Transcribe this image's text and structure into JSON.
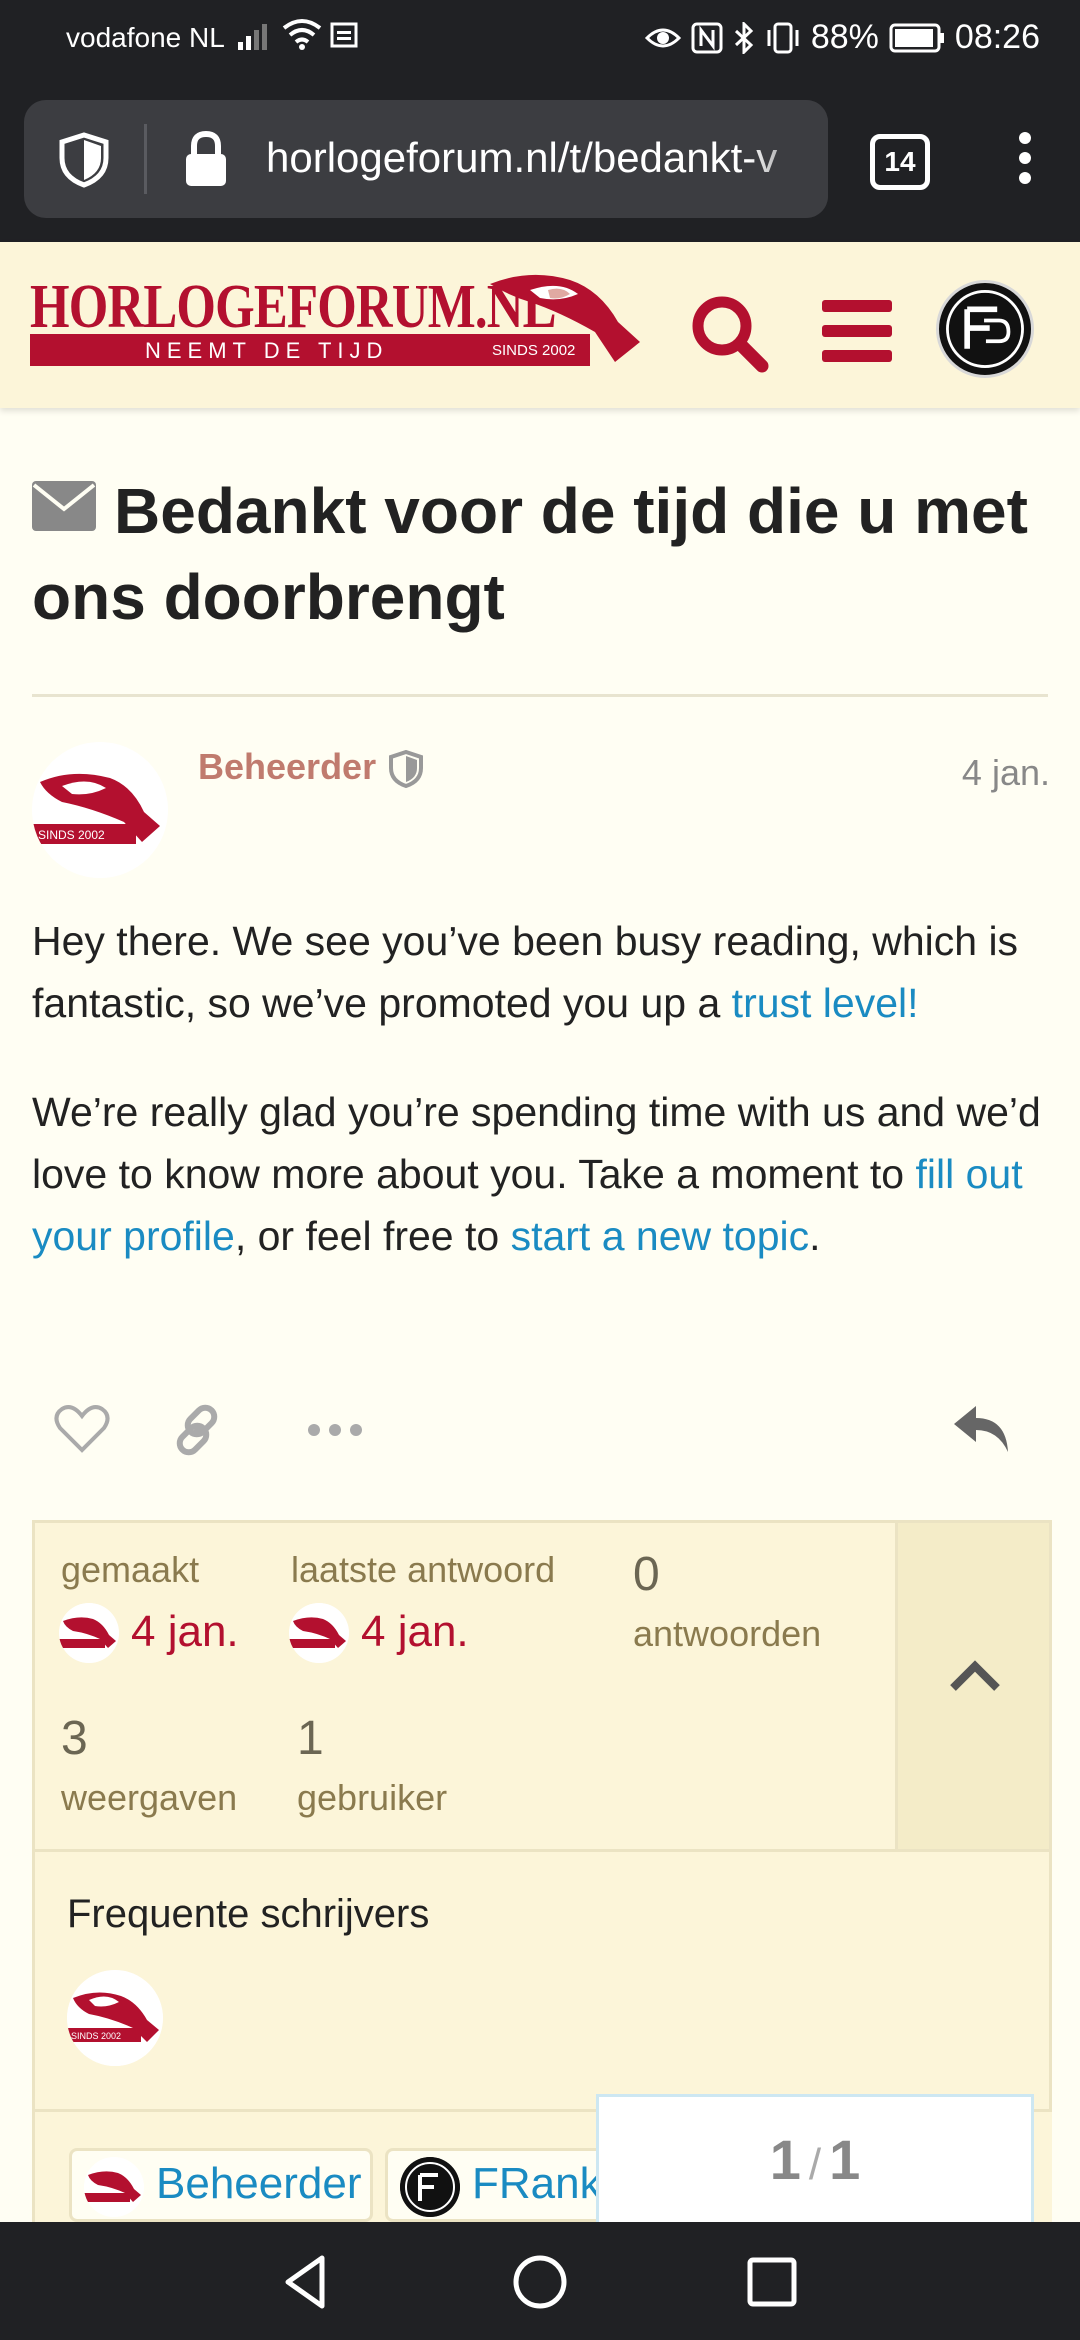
{
  "status_bar": {
    "carrier": "vodafone NL",
    "battery": "88%",
    "time": "08:26"
  },
  "browser": {
    "url": "horlogeforum.nl/t/bedankt-v",
    "tab_count": "14"
  },
  "site": {
    "logo_name": "HORLOGEFORUM.NL",
    "logo_tagline": "NEEMT DE TIJD",
    "logo_since": "SINDS 2002",
    "brand_color": "#b3102f"
  },
  "topic": {
    "title": "Bedankt voor de tijd die u met ons doorbrengt"
  },
  "post": {
    "author": "Beheerder",
    "date": "4 jan.",
    "p1_text": "Hey there. We see you’ve been busy reading, which is fantastic, so we’ve promoted you up a ",
    "p1_link": "trust level!",
    "p2_text_a": "We’re really glad you’re spending time with us and we’d love to know more about you. Take a moment to ",
    "p2_link_a": "fill out your profile",
    "p2_text_b": ", or feel free to ",
    "p2_link_b": "start a new topic",
    "p2_text_c": "."
  },
  "topic_map": {
    "created_label": "gemaakt",
    "created_date": "4 jan.",
    "last_reply_label": "laatste antwoord",
    "last_reply_date": "4 jan.",
    "replies_count": "0",
    "replies_label": "antwoorden",
    "views_count": "3",
    "views_label": "weergaven",
    "users_count": "1",
    "users_label": "gebruiker",
    "frequent_writers_heading": "Frequente schrijvers"
  },
  "participants": [
    {
      "name": "Beheerder"
    },
    {
      "name": "FRank"
    }
  ],
  "progress": {
    "current": "1",
    "total": "1"
  }
}
